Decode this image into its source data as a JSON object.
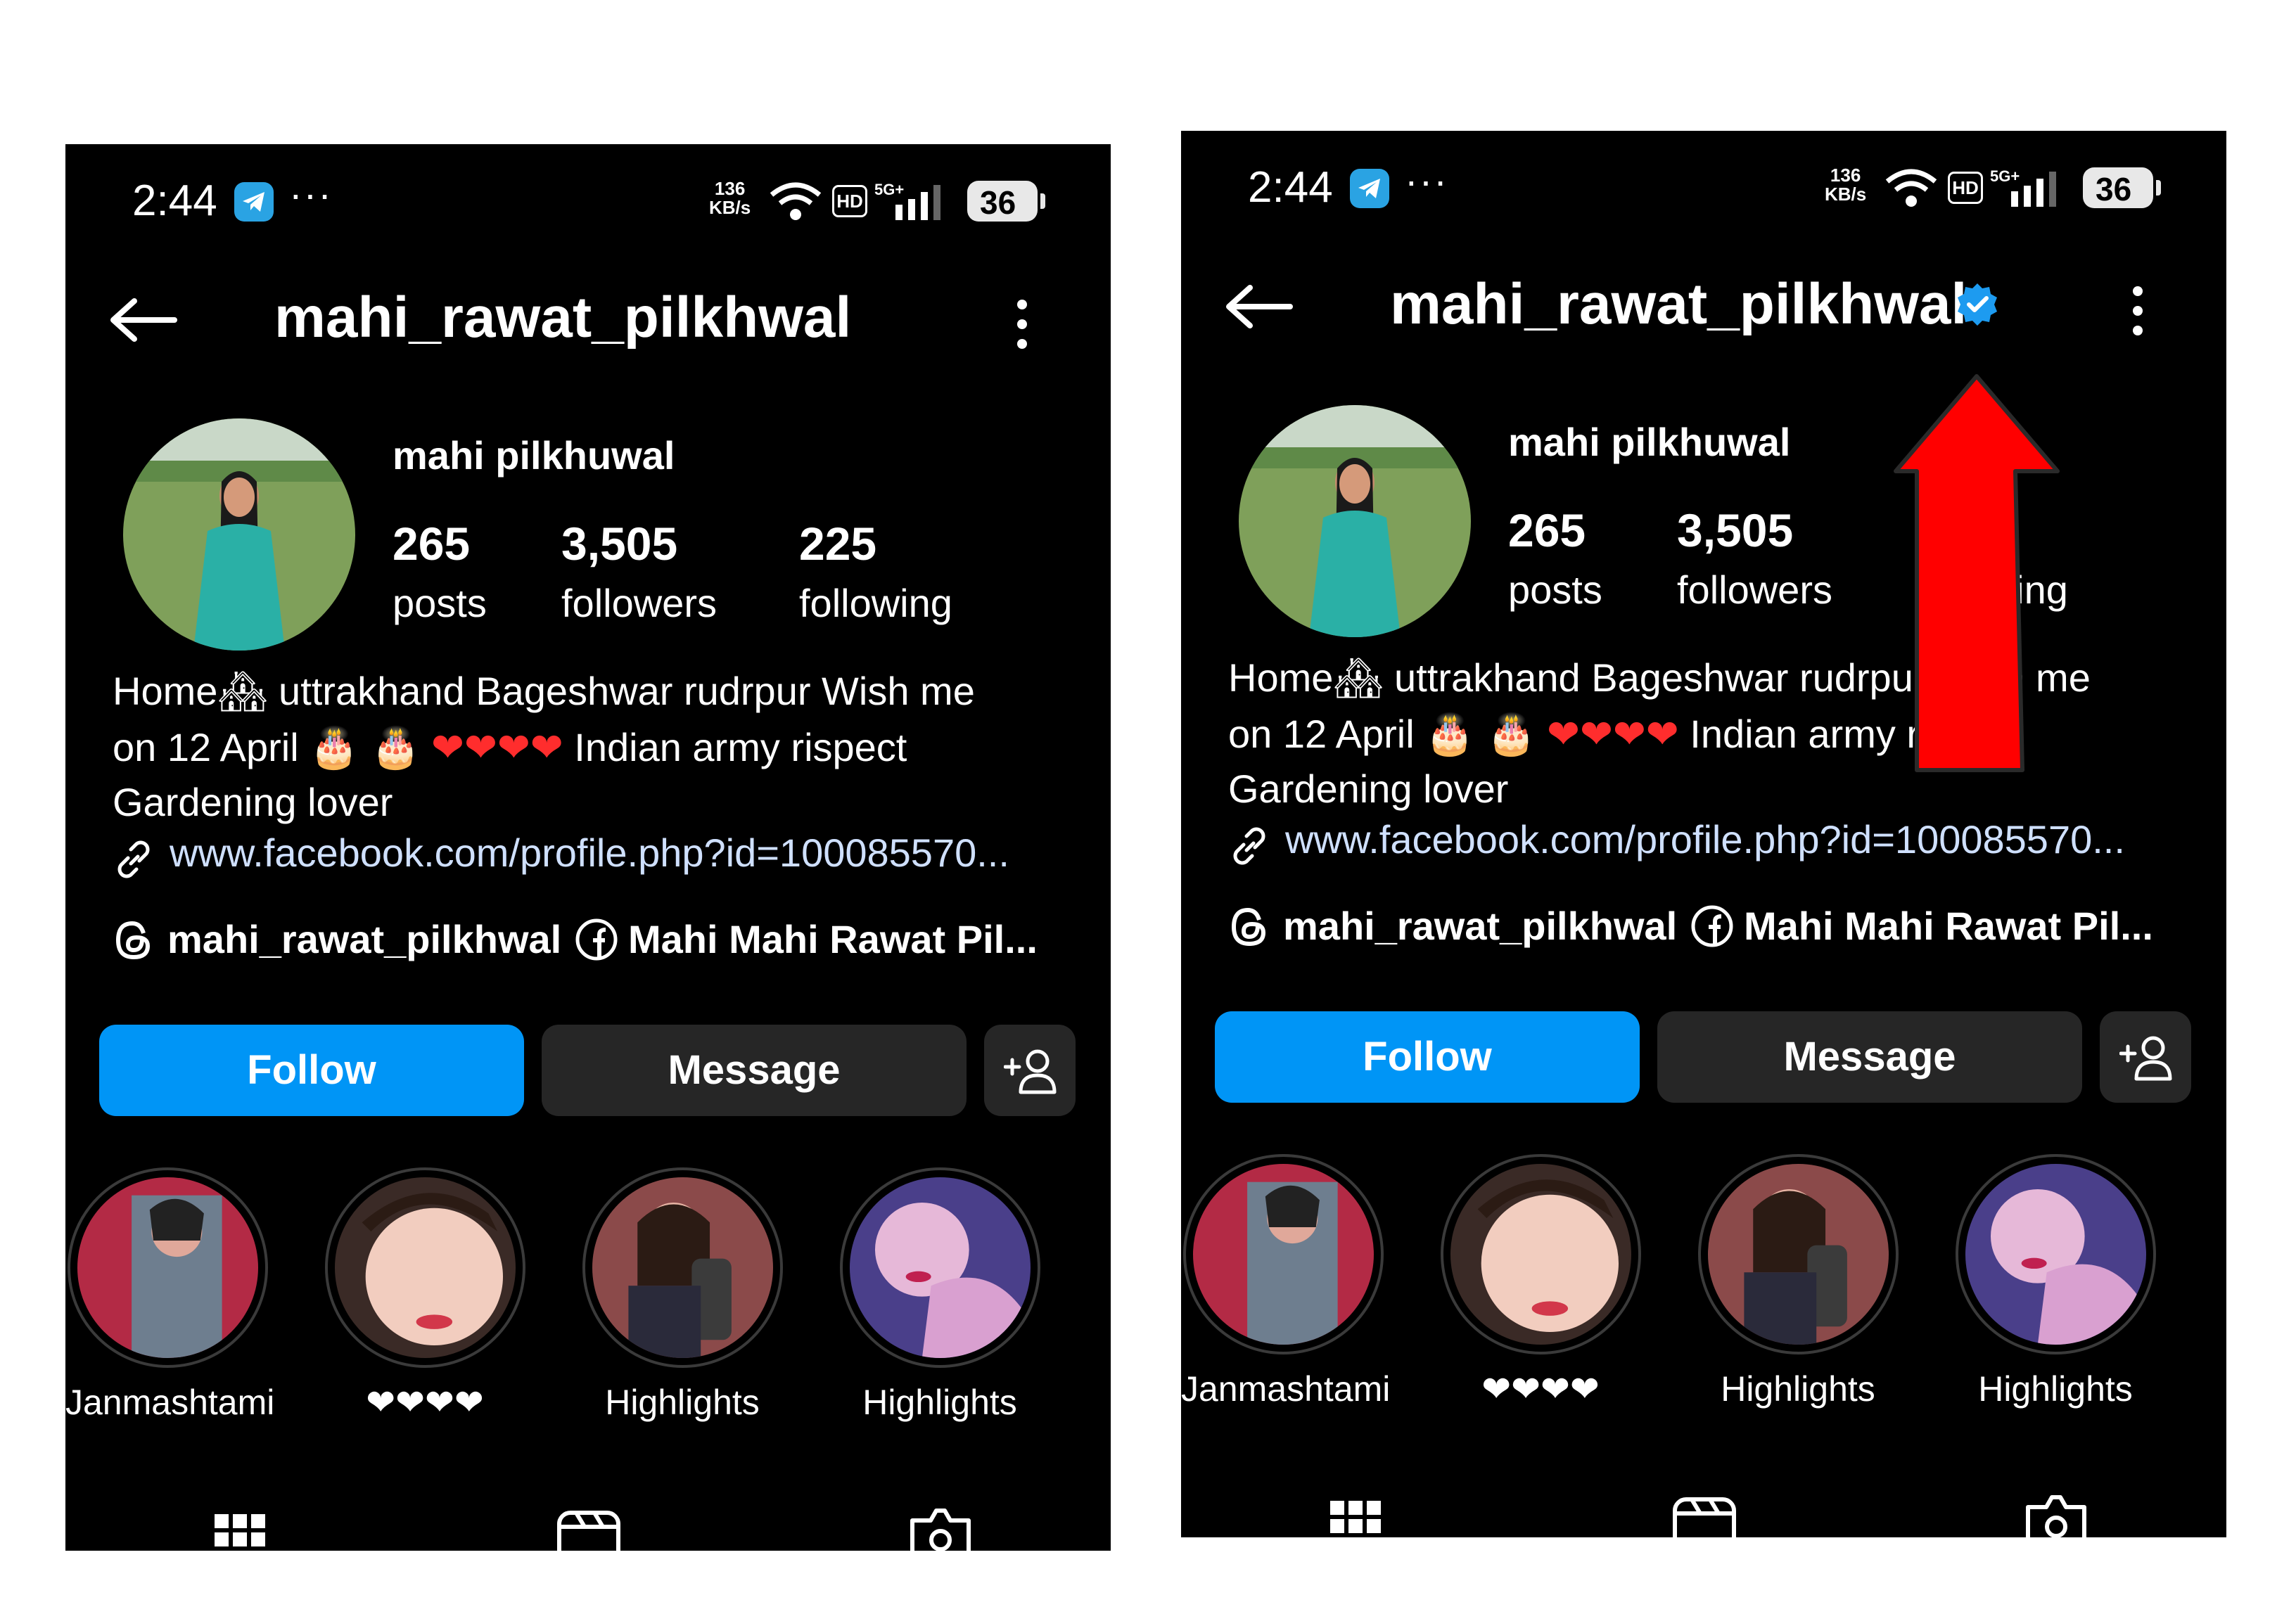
{
  "status_bar": {
    "time": "2:44",
    "dots": "···",
    "speed_value": "136",
    "speed_unit": "KB/s",
    "hd": "HD",
    "network": "5G+",
    "battery": "36"
  },
  "profile": {
    "username": "mahi_rawat_pilkhwal",
    "display_name": "mahi pilkhuwal",
    "stats": [
      {
        "value": "265",
        "label": "posts"
      },
      {
        "value": "3,505",
        "label": "followers"
      },
      {
        "value": "225",
        "label": "following"
      }
    ],
    "bio": {
      "line1_a": "Home",
      "line1_emoji": "🏘",
      "line1_b": " uttrakhand  Bageshwar rudrpur   Wish me",
      "line2_a": "on 12  April ",
      "line2_emoji": "🎂 🎂",
      "line2_hearts": "❤❤❤❤",
      "line2_b": " Indian army rispect",
      "line3": "Gardening lover"
    },
    "link": "www.facebook.com/profile.php?id=100085570...",
    "threads_handle": "mahi_rawat_pilkhwal",
    "facebook_name": "Mahi Mahi Rawat Pil..."
  },
  "actions": {
    "follow": "Follow",
    "message": "Message"
  },
  "highlights": [
    {
      "label": "Janmashtami"
    },
    {
      "label": "❤❤❤❤"
    },
    {
      "label": "Highlights"
    },
    {
      "label": "Highlights"
    }
  ],
  "colors": {
    "follow_blue": "#0095f6",
    "verified_blue": "#1d9bf0",
    "arrow_red": "#ff0000"
  },
  "icons": [
    "telegram-icon",
    "wifi-icon",
    "signal-icon",
    "back-arrow-icon",
    "verified-badge-icon",
    "more-vertical-icon",
    "link-icon",
    "threads-icon",
    "facebook-icon",
    "add-user-icon",
    "grid-icon",
    "reels-icon",
    "tagged-icon"
  ]
}
